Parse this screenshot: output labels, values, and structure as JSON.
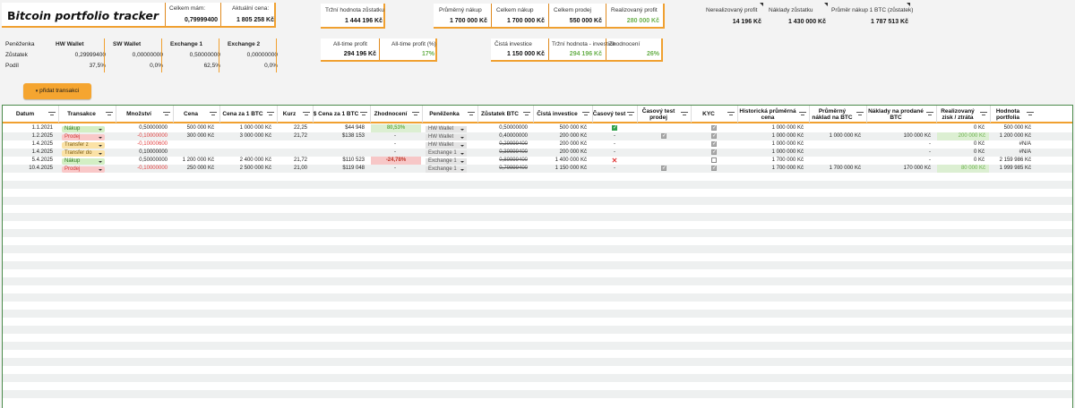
{
  "brand": {
    "title_prefix": "B",
    "title_rest": "itcoin portfolio tracker"
  },
  "summary": {
    "total_label": "Celkem mám:",
    "total_value": "0,79999400",
    "price_label": "Aktuální cena:",
    "price_value": "1 805 258 Kč"
  },
  "market": {
    "label": "Tržní hodnota zůstatku",
    "value": "1 444 196 Kč"
  },
  "purchase_stats": [
    {
      "label": "Průměrný nákup",
      "value": "1 700 000 Kč",
      "green": false
    },
    {
      "label": "Celkem nákup",
      "value": "1 700 000 Kč",
      "green": false
    },
    {
      "label": "Celkem prodej",
      "value": "550 000 Kč",
      "green": false
    },
    {
      "label": "Realizovaný profit",
      "value": "280 000 Kč",
      "green": true
    }
  ],
  "right_stats": [
    {
      "label": "Nerealizovaný profit",
      "value": "14 196 Kč"
    },
    {
      "label": "Náklady zůstatku",
      "value": "1 430 000 Kč"
    },
    {
      "label": "Průměr nákup 1 BTC (zůstatek)",
      "value": "1 787 513 Kč"
    }
  ],
  "alltime": [
    {
      "label": "All-time profit",
      "value": "294 196 Kč",
      "green": false
    },
    {
      "label": "All-time profit (%)",
      "value": "17%",
      "green": true
    }
  ],
  "investment": [
    {
      "label": "Čistá investice",
      "value": "1 150 000 Kč",
      "green": false
    },
    {
      "label": "Tržní hodnota - investice",
      "value": "294 196 Kč",
      "green": true
    },
    {
      "label": "Zhodnocení",
      "value": "26%",
      "green": true
    }
  ],
  "wallets": {
    "header_label": "Peněženka",
    "balance_label": "Zůstatek",
    "share_label": "Podíl",
    "columns": [
      {
        "name": "HW Wallet",
        "balance": "0,29999400",
        "share": "37,5%"
      },
      {
        "name": "SW Wallet",
        "balance": "0,00000000",
        "share": "0,0%"
      },
      {
        "name": "Exchange 1",
        "balance": "0,50000000",
        "share": "62,5%"
      },
      {
        "name": "Exchange 2",
        "balance": "0,00000000",
        "share": "0,0%"
      }
    ]
  },
  "add_button": {
    "icon": "▾",
    "label": "přidat transakci"
  },
  "table": {
    "headers": [
      "Datum",
      "Transakce",
      "Množství",
      "Cena",
      "Cena za 1 BTC",
      "Kurz",
      "$ Cena za 1 BTC",
      "Zhodnocení",
      "Peněženka",
      "Zůstatek BTC",
      "Čistá investice",
      "Časový test",
      "Časový test prodej",
      "KYC",
      "Historická průměrná cena",
      "Průměrný náklad na BTC",
      "Náklady na prodané BTC",
      "Realizovaný zisk / ztráta",
      "Hodnota portfolia"
    ],
    "rows": [
      {
        "date": "1.1.2021",
        "type": "Nákup",
        "type_color": "green",
        "qty": "0,50000000",
        "qty_neg": false,
        "price": "500 000 Kč",
        "price_btc": "1 000 000 Kč",
        "rate": "22,25",
        "usd": "$44 948",
        "gain": "80,53%",
        "gain_kind": "green",
        "wallet": "HW Wallet",
        "balance": "0,50000000",
        "balance_strike": false,
        "invest": "500 000 Kč",
        "time_test": "check-green",
        "time_test_sell": "",
        "kyc": "on",
        "hist_avg": "1 000 000 Kč",
        "avg_cost": "",
        "sold_cost": "",
        "realized": "0 Kč",
        "realized_hl": false,
        "portfolio": "500 000 Kč"
      },
      {
        "date": "1.2.2025",
        "type": "Prodej",
        "type_color": "red",
        "qty": "-0,10000000",
        "qty_neg": true,
        "price": "300 000 Kč",
        "price_btc": "3 000 000 Kč",
        "rate": "21,72",
        "usd": "$138 153",
        "gain": "-",
        "gain_kind": "",
        "wallet": "HW Wallet",
        "balance": "0,40000000",
        "balance_strike": false,
        "invest": "200 000 Kč",
        "time_test": "-",
        "time_test_sell": "on",
        "kyc": "on",
        "hist_avg": "1 000 000 Kč",
        "avg_cost": "1 000 000 Kč",
        "sold_cost": "100 000 Kč",
        "realized": "200 000 Kč",
        "realized_hl": true,
        "portfolio": "1 200 000 Kč"
      },
      {
        "date": "1.4.2025",
        "type": "Transfer z",
        "type_color": "orange",
        "qty": "-0,10000600",
        "qty_neg": true,
        "price": "",
        "price_btc": "",
        "rate": "",
        "usd": "",
        "gain": "-",
        "gain_kind": "",
        "wallet": "HW Wallet",
        "balance": "0,29999400",
        "balance_strike": true,
        "invest": "200 000 Kč",
        "time_test": "-",
        "time_test_sell": "",
        "kyc": "on",
        "hist_avg": "1 000 000 Kč",
        "avg_cost": "",
        "sold_cost": "-",
        "realized": "0 Kč",
        "realized_hl": false,
        "portfolio": "#N/A"
      },
      {
        "date": "1.4.2025",
        "type": "Transfer do",
        "type_color": "orange",
        "qty": "0,10000000",
        "qty_neg": false,
        "price": "",
        "price_btc": "",
        "rate": "",
        "usd": "",
        "gain": "-",
        "gain_kind": "",
        "wallet": "Exchange 1",
        "balance": "0,39999400",
        "balance_strike": true,
        "invest": "200 000 Kč",
        "time_test": "-",
        "time_test_sell": "",
        "kyc": "on",
        "hist_avg": "1 000 000 Kč",
        "avg_cost": "",
        "sold_cost": "-",
        "realized": "0 Kč",
        "realized_hl": false,
        "portfolio": "#N/A"
      },
      {
        "date": "5.4.2025",
        "type": "Nákup",
        "type_color": "green",
        "qty": "0,50000000",
        "qty_neg": false,
        "price": "1 200 000 Kč",
        "price_btc": "2 400 000 Kč",
        "rate": "21,72",
        "usd": "$110 523",
        "gain": "-24,78%",
        "gain_kind": "red",
        "wallet": "Exchange 1",
        "balance": "0,89999400",
        "balance_strike": true,
        "invest": "1 400 000 Kč",
        "time_test": "x",
        "time_test_sell": "",
        "kyc": "off",
        "hist_avg": "1 700 000 Kč",
        "avg_cost": "",
        "sold_cost": "-",
        "realized": "0 Kč",
        "realized_hl": false,
        "portfolio": "2 159 986 Kč"
      },
      {
        "date": "10.4.2025",
        "type": "Prodej",
        "type_color": "red",
        "qty": "-0,10000000",
        "qty_neg": true,
        "price": "250 000 Kč",
        "price_btc": "2 500 000 Kč",
        "rate": "21,00",
        "usd": "$119 048",
        "gain": "-",
        "gain_kind": "",
        "wallet": "Exchange 1",
        "balance": "0,79999400",
        "balance_strike": true,
        "invest": "1 150 000 Kč",
        "time_test": "-",
        "time_test_sell": "on",
        "kyc": "on",
        "hist_avg": "1 700 000 Kč",
        "avg_cost": "1 700 000 Kč",
        "sold_cost": "170 000 Kč",
        "realized": "80 000 Kč",
        "realized_hl": true,
        "portfolio": "1 999 985 Kč"
      }
    ]
  },
  "colors": {
    "accent": "#f0a030",
    "green_chip": "#d3efc4",
    "red_chip": "#f9c8c8",
    "orange_chip": "#fbe2a6"
  },
  "icons": {
    "dropdown": "chevron-down-icon",
    "filter": "filter-icon",
    "check": "checkbox-icon",
    "cross": "cross-icon"
  }
}
